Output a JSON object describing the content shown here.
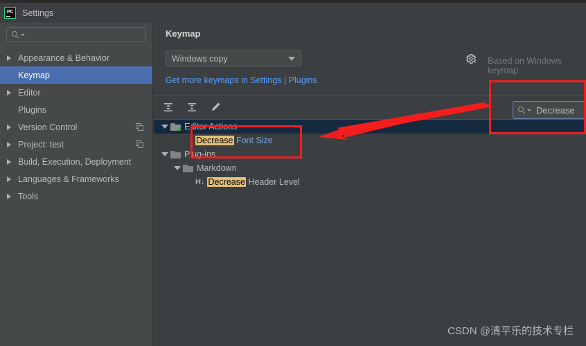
{
  "window": {
    "title": "Settings",
    "app_icon": "pycharm-icon"
  },
  "sidebar": {
    "search_placeholder": "",
    "items": [
      {
        "label": "Appearance & Behavior",
        "expandable": true,
        "selected": false,
        "copy_icon": false
      },
      {
        "label": "Keymap",
        "expandable": false,
        "selected": true,
        "copy_icon": false
      },
      {
        "label": "Editor",
        "expandable": true,
        "selected": false,
        "copy_icon": false
      },
      {
        "label": "Plugins",
        "expandable": false,
        "selected": false,
        "copy_icon": false
      },
      {
        "label": "Version Control",
        "expandable": true,
        "selected": false,
        "copy_icon": true
      },
      {
        "label": "Project: test",
        "expandable": true,
        "selected": false,
        "copy_icon": true
      },
      {
        "label": "Build, Execution, Deployment",
        "expandable": true,
        "selected": false,
        "copy_icon": false
      },
      {
        "label": "Languages & Frameworks",
        "expandable": true,
        "selected": false,
        "copy_icon": false
      },
      {
        "label": "Tools",
        "expandable": true,
        "selected": false,
        "copy_icon": false
      }
    ]
  },
  "main": {
    "title": "Keymap",
    "keymap_select": {
      "value": "Windows copy",
      "icon": "chevron-down-icon"
    },
    "gear_icon": "gear-icon",
    "based_on": "Based on Windows keymap",
    "get_more_link": "Get more keymaps in Settings | Plugins",
    "toolbar": [
      {
        "name": "expand-all-icon",
        "tooltip": "Expand All"
      },
      {
        "name": "collapse-all-icon",
        "tooltip": "Collapse All"
      },
      {
        "name": "edit-shortcut-icon",
        "tooltip": "Edit Shortcut"
      }
    ],
    "find_field": {
      "value": "Decrease",
      "icon": "search-icon"
    },
    "tree": [
      {
        "icon": "editor-actions-icon",
        "indent": 0,
        "expandable": true,
        "selected": true,
        "pre_match": "",
        "match": "",
        "post_match": "Editor Actions",
        "style": "plain"
      },
      {
        "icon": "none",
        "indent": 2,
        "expandable": false,
        "selected": false,
        "pre_match": "",
        "match": "Decrease",
        "post_match": " Font Size",
        "style": "blue"
      },
      {
        "icon": "folder-icon",
        "indent": 0,
        "expandable": true,
        "selected": false,
        "pre_match": "",
        "match": "",
        "post_match": "Plug-ins",
        "style": "plain"
      },
      {
        "icon": "folder-icon",
        "indent": 1,
        "expandable": true,
        "selected": false,
        "pre_match": "",
        "match": "",
        "post_match": "Markdown",
        "style": "plain"
      },
      {
        "icon": "header-level-icon",
        "indent": 2,
        "expandable": false,
        "selected": false,
        "pre_match": "",
        "match": "Decrease",
        "post_match": " Header Level",
        "style": "plain"
      }
    ]
  },
  "annotations": {
    "watermark": "CSDN @清平乐的技术专栏",
    "highlight_color": "#f41d1d",
    "arrow": "red-arrow-pointing-left"
  },
  "icons": {
    "header_level_glyph": "H↓"
  },
  "colors": {
    "panel_bg": "#3c3f41",
    "sidebar_bg": "#45494a",
    "selection_blue": "#4b6eaf",
    "tree_selection": "#15293f",
    "link_blue": "#589df6",
    "match_highlight": "#e3bf78",
    "annotation_red": "#f41d1d"
  }
}
